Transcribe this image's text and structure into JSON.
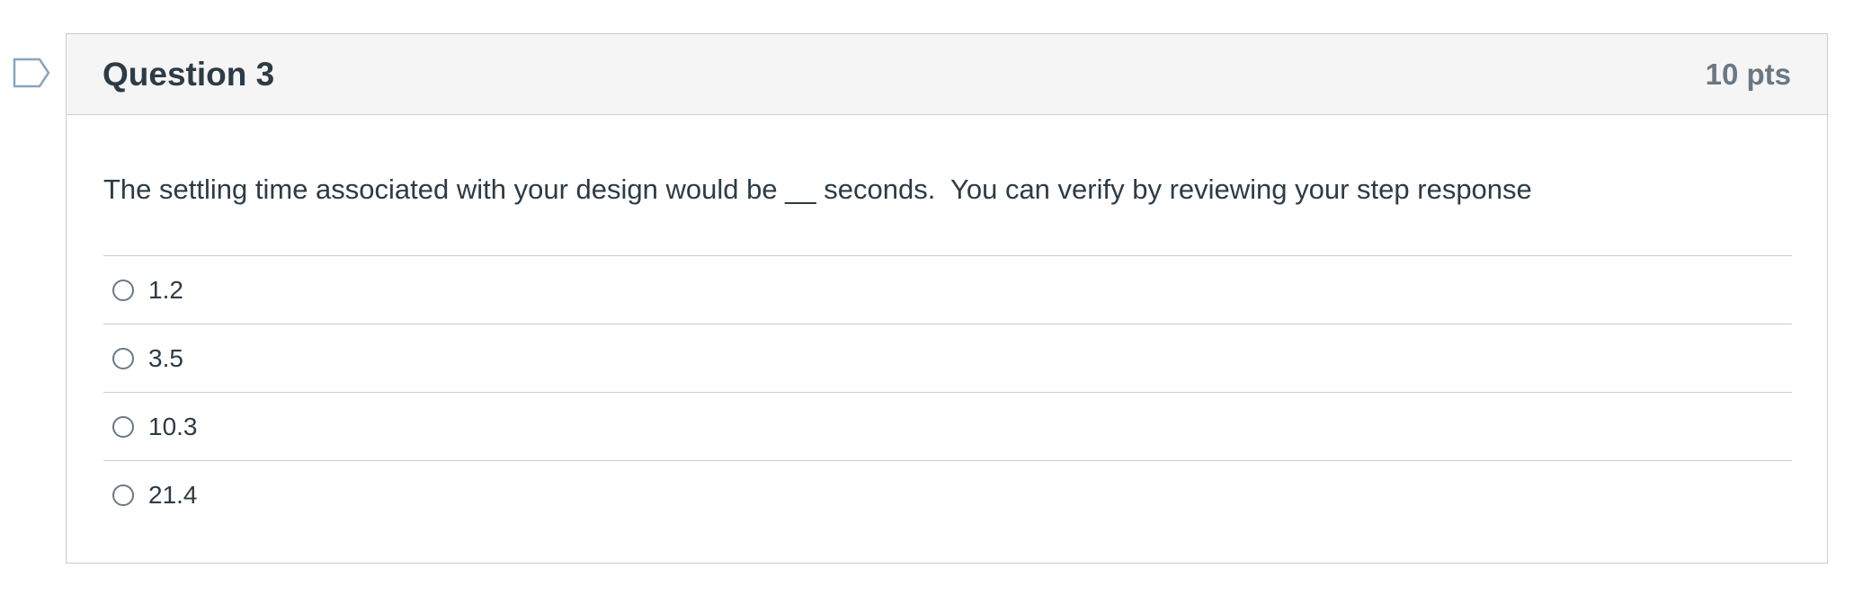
{
  "question": {
    "title": "Question 3",
    "points": "10 pts",
    "text": "The settling time associated with your design would be __ seconds.  You can verify by reviewing your step response",
    "answers": [
      {
        "label": "1.2"
      },
      {
        "label": "3.5"
      },
      {
        "label": "10.3"
      },
      {
        "label": "21.4"
      }
    ]
  },
  "icons": {
    "flag": "flag-question-icon"
  },
  "colors": {
    "header_bg": "#f5f5f5",
    "border": "#c7cdd1",
    "text": "#2d3b45",
    "muted": "#6a7883",
    "flag": "#8aa4bf"
  }
}
